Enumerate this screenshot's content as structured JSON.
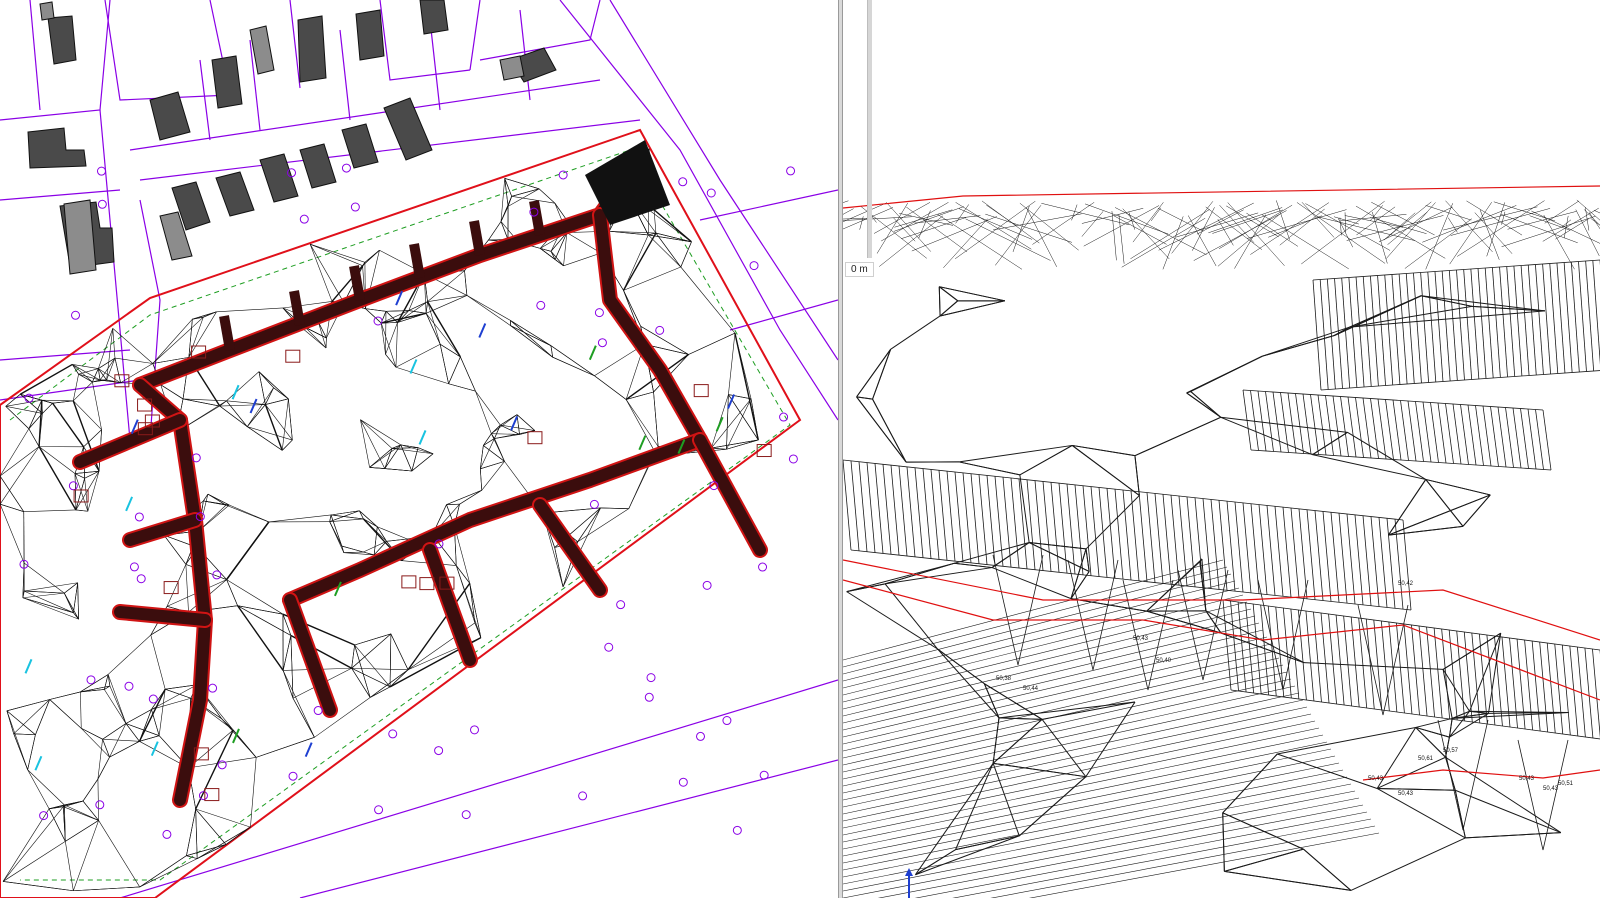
{
  "plan_view": {
    "title": "",
    "colors": {
      "parcel_lines": "#8a00e6",
      "building_fill": "#4a4a4a",
      "building_fill_light": "#8c8c8c",
      "tin_mesh": "#111111",
      "pipe_fill": "#3b0d0d",
      "pipe_outline": "#d01414",
      "boundary": "#e0101a",
      "survey_marks": "#1e3fd1",
      "green_marks": "#1e9e22",
      "cyan_marks": "#19c3e0",
      "label_marks": "#8a1a1a"
    }
  },
  "view_3d": {
    "scale_label": "0 m",
    "elevation_labels": [
      "50,43",
      "50,43",
      "50,57",
      "50,61",
      "50,43",
      "50,43",
      "50,51",
      "50,38",
      "50,44",
      "50,43",
      "50,40",
      "50,42"
    ],
    "colors": {
      "mesh": "#1a1a1a",
      "edge_red": "#e01010",
      "axis": "#1e3fd1"
    },
    "axis_icon": "z-axis-arrow-icon"
  }
}
